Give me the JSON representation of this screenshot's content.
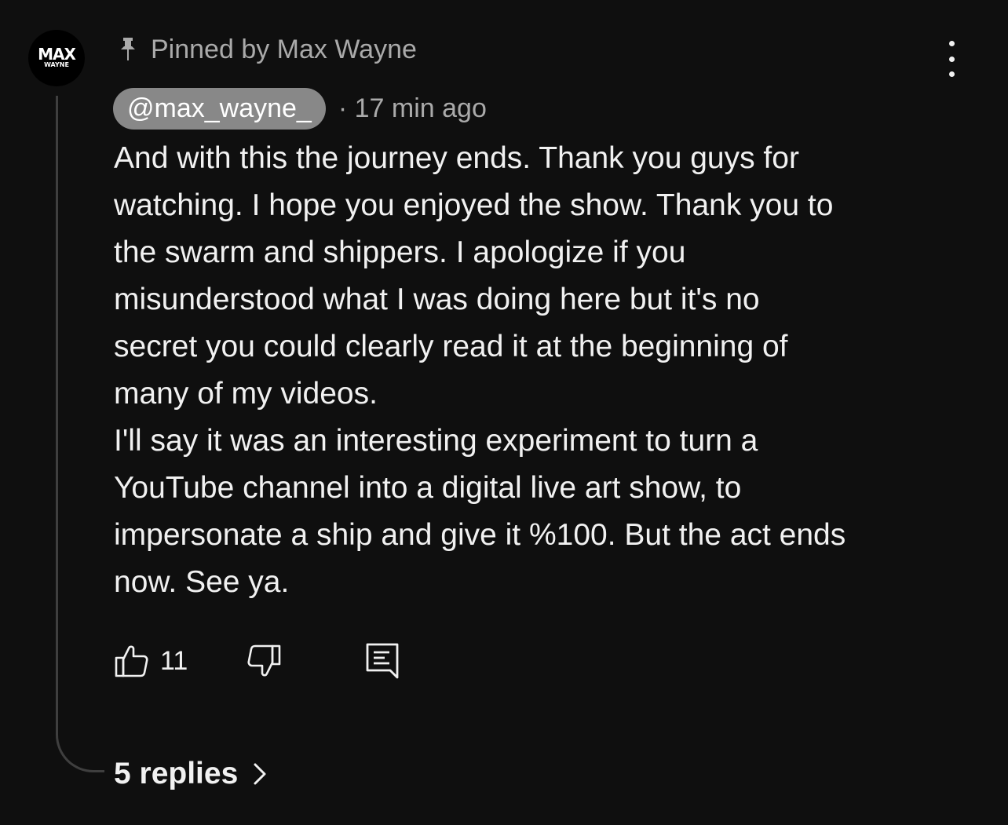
{
  "avatar": {
    "top_text": "MAX",
    "bottom_text": "WAYNE"
  },
  "pinned": {
    "label": "Pinned by Max Wayne",
    "icon": "pin-icon"
  },
  "comment": {
    "author_handle": "@max_wayne_",
    "separator": "·",
    "time_ago": "17 min ago",
    "text": "And with this the journey ends. Thank you guys for\nwatching. I hope you enjoyed the show. Thank you to\nthe swarm and shippers. I apologize if you\nmisunderstood what I was doing here but it's no\nsecret you could clearly read it at the beginning of\nmany of my videos.\nI'll say it was an interesting experiment to turn a\nYouTube channel into a digital live art show, to\nimpersonate a ship and give it %100. But the act ends\nnow. See ya."
  },
  "actions": {
    "like_icon": "thumbs-up-icon",
    "like_count": "11",
    "dislike_icon": "thumbs-down-icon",
    "reply_icon": "comment-reply-icon"
  },
  "replies": {
    "label": "5 replies",
    "icon": "chevron-right-icon"
  },
  "menu": {
    "icon": "more-vertical-icon"
  },
  "colors": {
    "background": "#0f0f0f",
    "text_primary": "#f1f1f1",
    "text_secondary": "#aaaaaa",
    "handle_chip": "#888888",
    "thread_line": "#3f3f3f"
  }
}
